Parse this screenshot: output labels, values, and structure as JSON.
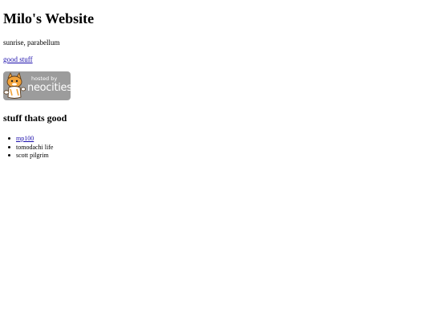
{
  "page": {
    "title": "Milo's Website",
    "tagline": "sunrise, parabellum",
    "good_link": "good stuff",
    "badge": {
      "line1": "hosted by",
      "line2": "neocities",
      "icon": "neocities-cat-logo"
    },
    "section_heading": "stuff thats good",
    "items": [
      {
        "label": "mp100",
        "is_link": true
      },
      {
        "label": "tomodachi life",
        "is_link": false
      },
      {
        "label": "scott pilgrim",
        "is_link": false
      }
    ]
  },
  "colors": {
    "link": "#1a0dab",
    "badge_bg": "#9c9c9c",
    "text": "#000000",
    "background": "#ffffff"
  }
}
